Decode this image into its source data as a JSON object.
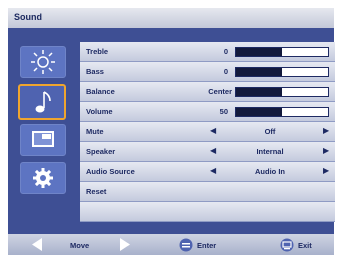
{
  "title": "Sound",
  "sidebar": [
    {
      "icon": "brightness-icon",
      "active": false
    },
    {
      "icon": "music-note-icon",
      "active": true
    },
    {
      "icon": "screen-icon",
      "active": false
    },
    {
      "icon": "gear-icon",
      "active": false
    }
  ],
  "menu": {
    "treble": {
      "label": "Treble",
      "value": "0",
      "level": 0.5
    },
    "bass": {
      "label": "Bass",
      "value": "0",
      "level": 0.5
    },
    "balance": {
      "label": "Balance",
      "value": "Center",
      "level": 0.5
    },
    "volume": {
      "label": "Volume",
      "value": "50",
      "level": 0.5
    },
    "mute": {
      "label": "Mute",
      "value": "Off"
    },
    "speaker": {
      "label": "Speaker",
      "value": "Internal"
    },
    "audio_source": {
      "label": "Audio Source",
      "value": "Audio In"
    },
    "reset": {
      "label": "Reset"
    }
  },
  "footer": {
    "move": "Move",
    "enter": "Enter",
    "exit": "Exit"
  }
}
